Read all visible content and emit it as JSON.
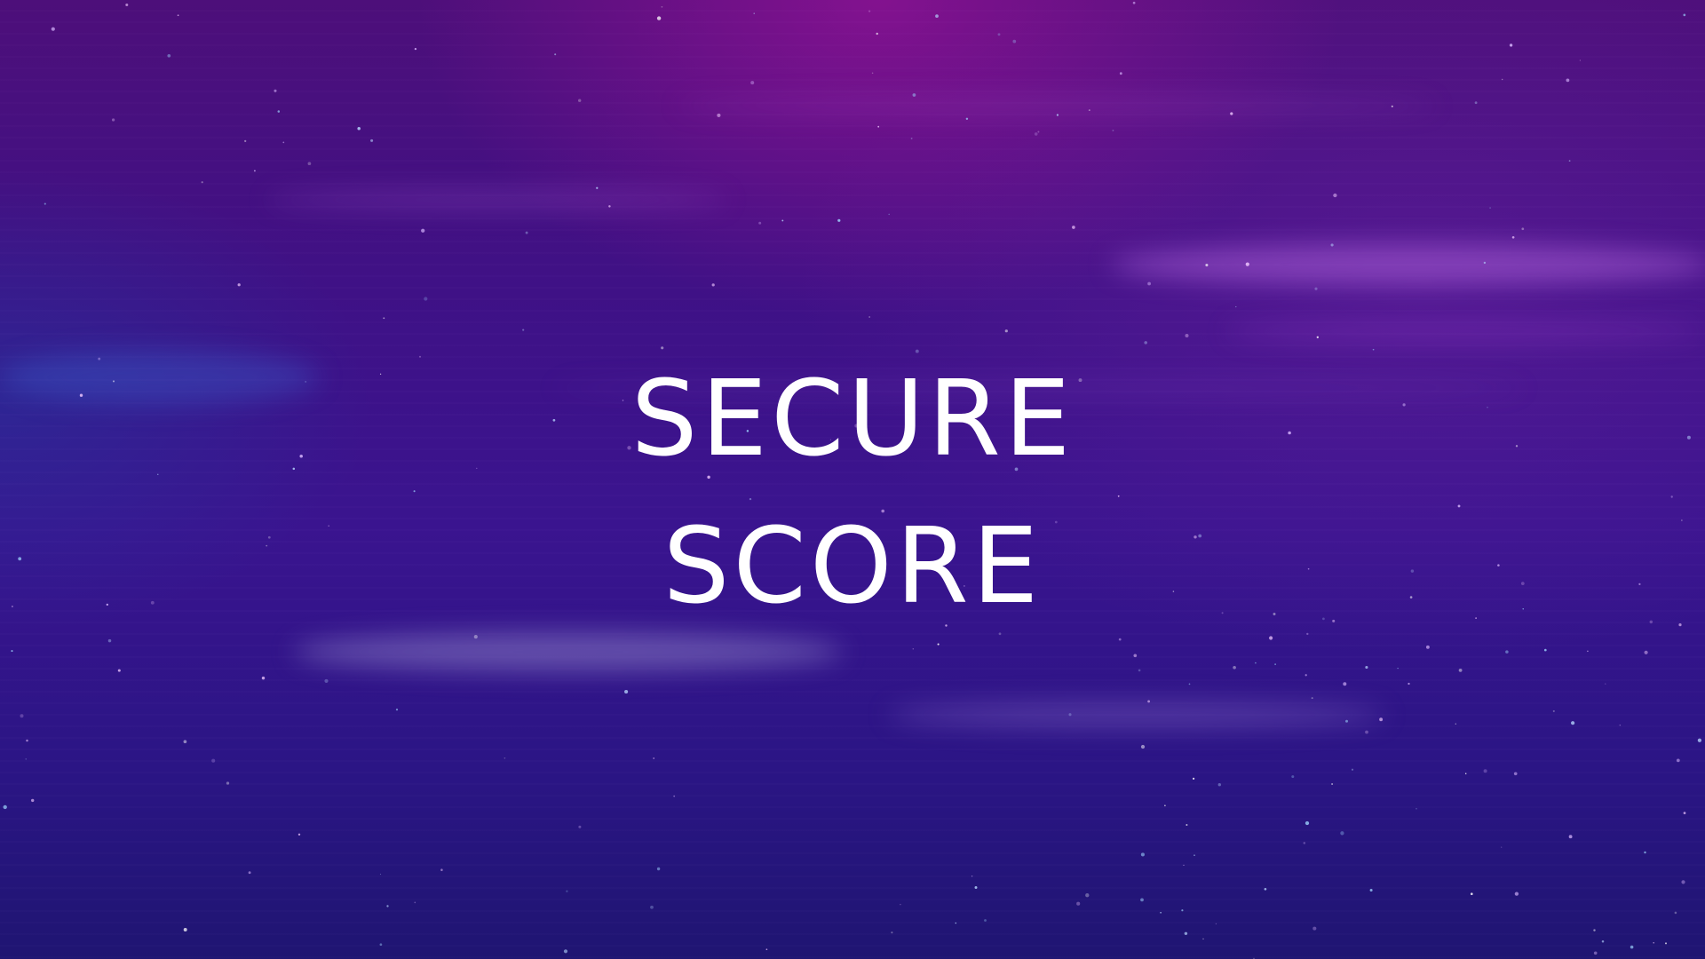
{
  "slide": {
    "title_line_1": "SECURE",
    "title_line_2": "SCORE"
  },
  "colors": {
    "background_top": "#4d0f7a",
    "background_mid": "#3a148f",
    "background_bottom": "#1f1572",
    "glow_magenta": "#af14a0",
    "text": "#ffffff"
  }
}
